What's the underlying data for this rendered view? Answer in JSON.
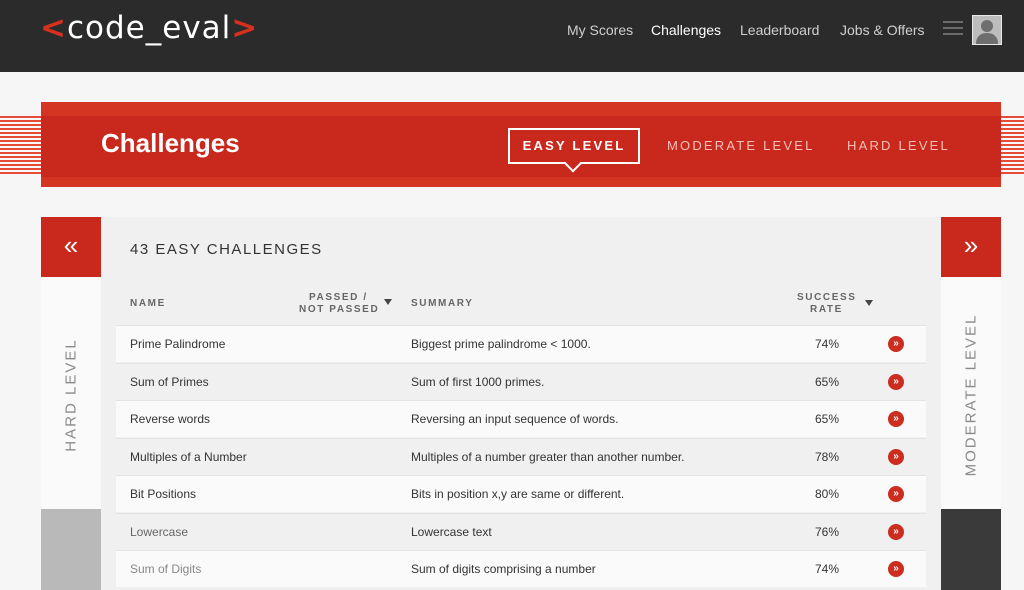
{
  "logo": {
    "open": "<",
    "text": "code_eval",
    "close": ">"
  },
  "nav": {
    "my_scores": "My Scores",
    "challenges": "Challenges",
    "leaderboard": "Leaderboard",
    "jobs": "Jobs & Offers"
  },
  "banner": {
    "title": "Challenges",
    "easy": "EASY LEVEL",
    "moderate": "MODERATE LEVEL",
    "hard": "HARD LEVEL"
  },
  "left_panel": {
    "arrow": "«",
    "label": "HARD LEVEL"
  },
  "right_panel": {
    "arrow": "»",
    "label": "MODERATE LEVEL"
  },
  "table": {
    "count_title": "43 EASY CHALLENGES",
    "headers": {
      "name": "NAME",
      "passed_1": "PASSED /",
      "passed_2": "NOT PASSED",
      "summary": "SUMMARY",
      "rate_1": "SUCCESS",
      "rate_2": "RATE"
    },
    "rows": [
      {
        "name": "Prime Palindrome",
        "summary": "Biggest prime palindrome < 1000.",
        "rate": "74%"
      },
      {
        "name": "Sum of Primes",
        "summary": "Sum of first 1000 primes.",
        "rate": "65%"
      },
      {
        "name": "Reverse words",
        "summary": "Reversing an input sequence of words.",
        "rate": "65%"
      },
      {
        "name": "Multiples of a Number",
        "summary": "Multiples of a number greater than another number.",
        "rate": "78%"
      },
      {
        "name": "Bit Positions",
        "summary": "Bits in position x,y are same or different.",
        "rate": "80%"
      },
      {
        "name": "Lowercase",
        "summary": "Lowercase text",
        "rate": "76%"
      },
      {
        "name": "Sum of Digits",
        "summary": "Sum of digits comprising a number",
        "rate": "74%"
      }
    ]
  },
  "colors": {
    "accent": "#c9291d",
    "topbar": "#2b2b2b"
  },
  "icons": {
    "go": "chevron-double-right-icon",
    "menu": "hamburger-icon",
    "user": "user-avatar-icon"
  }
}
